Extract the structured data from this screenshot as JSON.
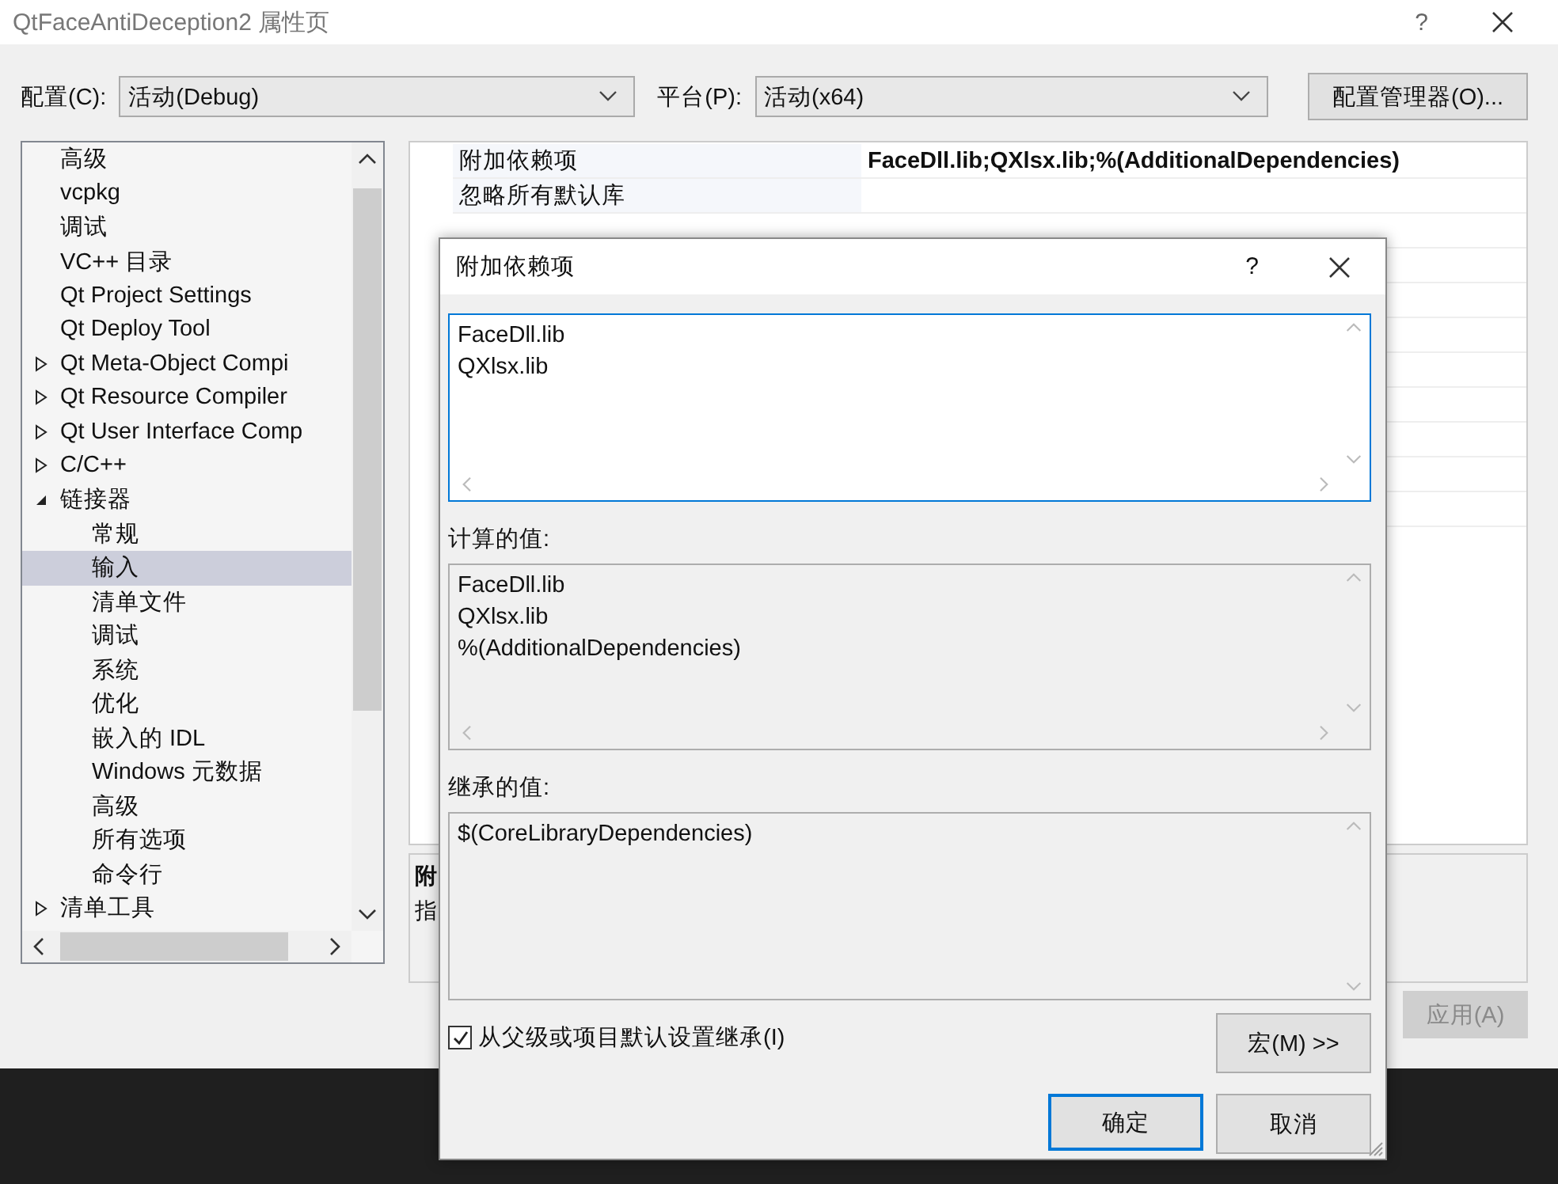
{
  "window": {
    "title": "QtFaceAntiDeception2 属性页",
    "help": "?"
  },
  "config": {
    "label": "配置(C):",
    "value": "活动(Debug)"
  },
  "platform": {
    "label": "平台(P):",
    "value": "活动(x64)"
  },
  "config_manager_button": "配置管理器(O)...",
  "tree": [
    {
      "label": "高级",
      "kind": "leaf",
      "selected": false
    },
    {
      "label": "vcpkg",
      "kind": "leaf",
      "selected": false
    },
    {
      "label": "调试",
      "kind": "leaf",
      "selected": false
    },
    {
      "label": "VC++ 目录",
      "kind": "leaf",
      "selected": false
    },
    {
      "label": "Qt Project Settings",
      "kind": "leaf",
      "selected": false
    },
    {
      "label": "Qt Deploy Tool",
      "kind": "leaf",
      "selected": false
    },
    {
      "label": "Qt Meta-Object Compi",
      "kind": "folder",
      "expanded": false,
      "selected": false
    },
    {
      "label": "Qt Resource Compiler",
      "kind": "folder",
      "expanded": false,
      "selected": false
    },
    {
      "label": "Qt User Interface Comp",
      "kind": "folder",
      "expanded": false,
      "selected": false
    },
    {
      "label": "C/C++",
      "kind": "folder",
      "expanded": false,
      "selected": false
    },
    {
      "label": "链接器",
      "kind": "folder",
      "expanded": true,
      "selected": false,
      "children": [
        {
          "label": "常规",
          "kind": "leaf",
          "selected": false
        },
        {
          "label": "输入",
          "kind": "leaf",
          "selected": true
        },
        {
          "label": "清单文件",
          "kind": "leaf",
          "selected": false
        },
        {
          "label": "调试",
          "kind": "leaf",
          "selected": false
        },
        {
          "label": "系统",
          "kind": "leaf",
          "selected": false
        },
        {
          "label": "优化",
          "kind": "leaf",
          "selected": false
        },
        {
          "label": "嵌入的 IDL",
          "kind": "leaf",
          "selected": false
        },
        {
          "label": "Windows 元数据",
          "kind": "leaf",
          "selected": false
        },
        {
          "label": "高级",
          "kind": "leaf",
          "selected": false
        },
        {
          "label": "所有选项",
          "kind": "leaf",
          "selected": false
        },
        {
          "label": "命令行",
          "kind": "leaf",
          "selected": false
        }
      ]
    },
    {
      "label": "清单工具",
      "kind": "folder",
      "expanded": false,
      "selected": false
    }
  ],
  "grid": {
    "rows": [
      {
        "name": "附加依赖项",
        "value": "FaceDll.lib;QXlsx.lib;%(AdditionalDependencies)"
      },
      {
        "name": "忽略所有默认库"
      },
      {}
    ]
  },
  "description": {
    "title": "附",
    "text": "指"
  },
  "apply_button": {
    "label": "应用(A)",
    "disabled": true
  },
  "dialog": {
    "title": "附加依赖项",
    "help": "?",
    "edit_lines": [
      "FaceDll.lib",
      "QXlsx.lib"
    ],
    "evaluated_label": "计算的值:",
    "evaluated_lines": [
      "FaceDll.lib",
      "QXlsx.lib",
      "%(AdditionalDependencies)"
    ],
    "inherited_label": "继承的值:",
    "inherited_lines": [
      "$(CoreLibraryDependencies)"
    ],
    "inherit_checkbox": {
      "label": "从父级或项目默认设置继承(I)",
      "checked": true
    },
    "macros_button": "宏(M) >>",
    "ok_button": "确定",
    "cancel_button": "取消"
  }
}
